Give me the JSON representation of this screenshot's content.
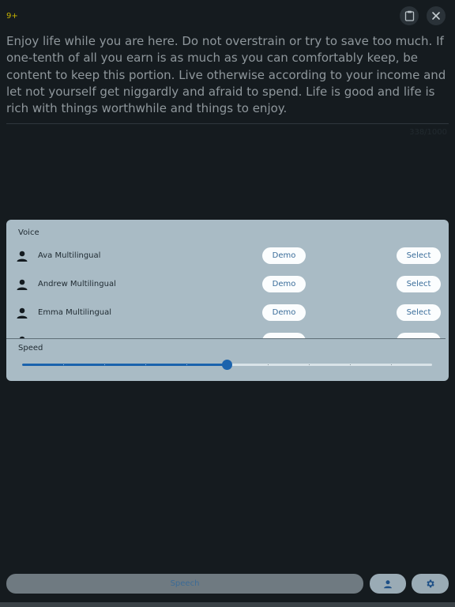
{
  "header": {
    "badge": "9+"
  },
  "editor": {
    "text": "Enjoy life while you are here. Do not overstrain or try to save too much. If one-tenth of all you earn is as much as you can comfortably keep, be content to keep this portion. Live otherwise according to your income and let not yourself get niggardly and afraid to spend. Life is good and life is rich with things worthwhile and things to enjoy.",
    "counter": "338/1000"
  },
  "voice_panel": {
    "title": "Voice",
    "voices": [
      {
        "name": "Ava Multilingual",
        "demo_label": "Demo",
        "select_label": "Select"
      },
      {
        "name": "Andrew Multilingual",
        "demo_label": "Demo",
        "select_label": "Select"
      },
      {
        "name": "Emma Multilingual",
        "demo_label": "Demo",
        "select_label": "Select"
      },
      {
        "name": "",
        "demo_label": "",
        "select_label": ""
      }
    ]
  },
  "speed": {
    "label": "Speed",
    "value_fraction": 0.5,
    "tick_count": 10
  },
  "bottom_bar": {
    "speech_label": "Speech"
  },
  "icons": {
    "clipboard": "clipboard-icon",
    "close": "close-icon",
    "person": "person-icon",
    "settings": "gear-icon"
  },
  "colors": {
    "background": "#151b1f",
    "panel": "#a9bbc5",
    "accent": "#1b63ad",
    "badge": "#c8b400"
  }
}
